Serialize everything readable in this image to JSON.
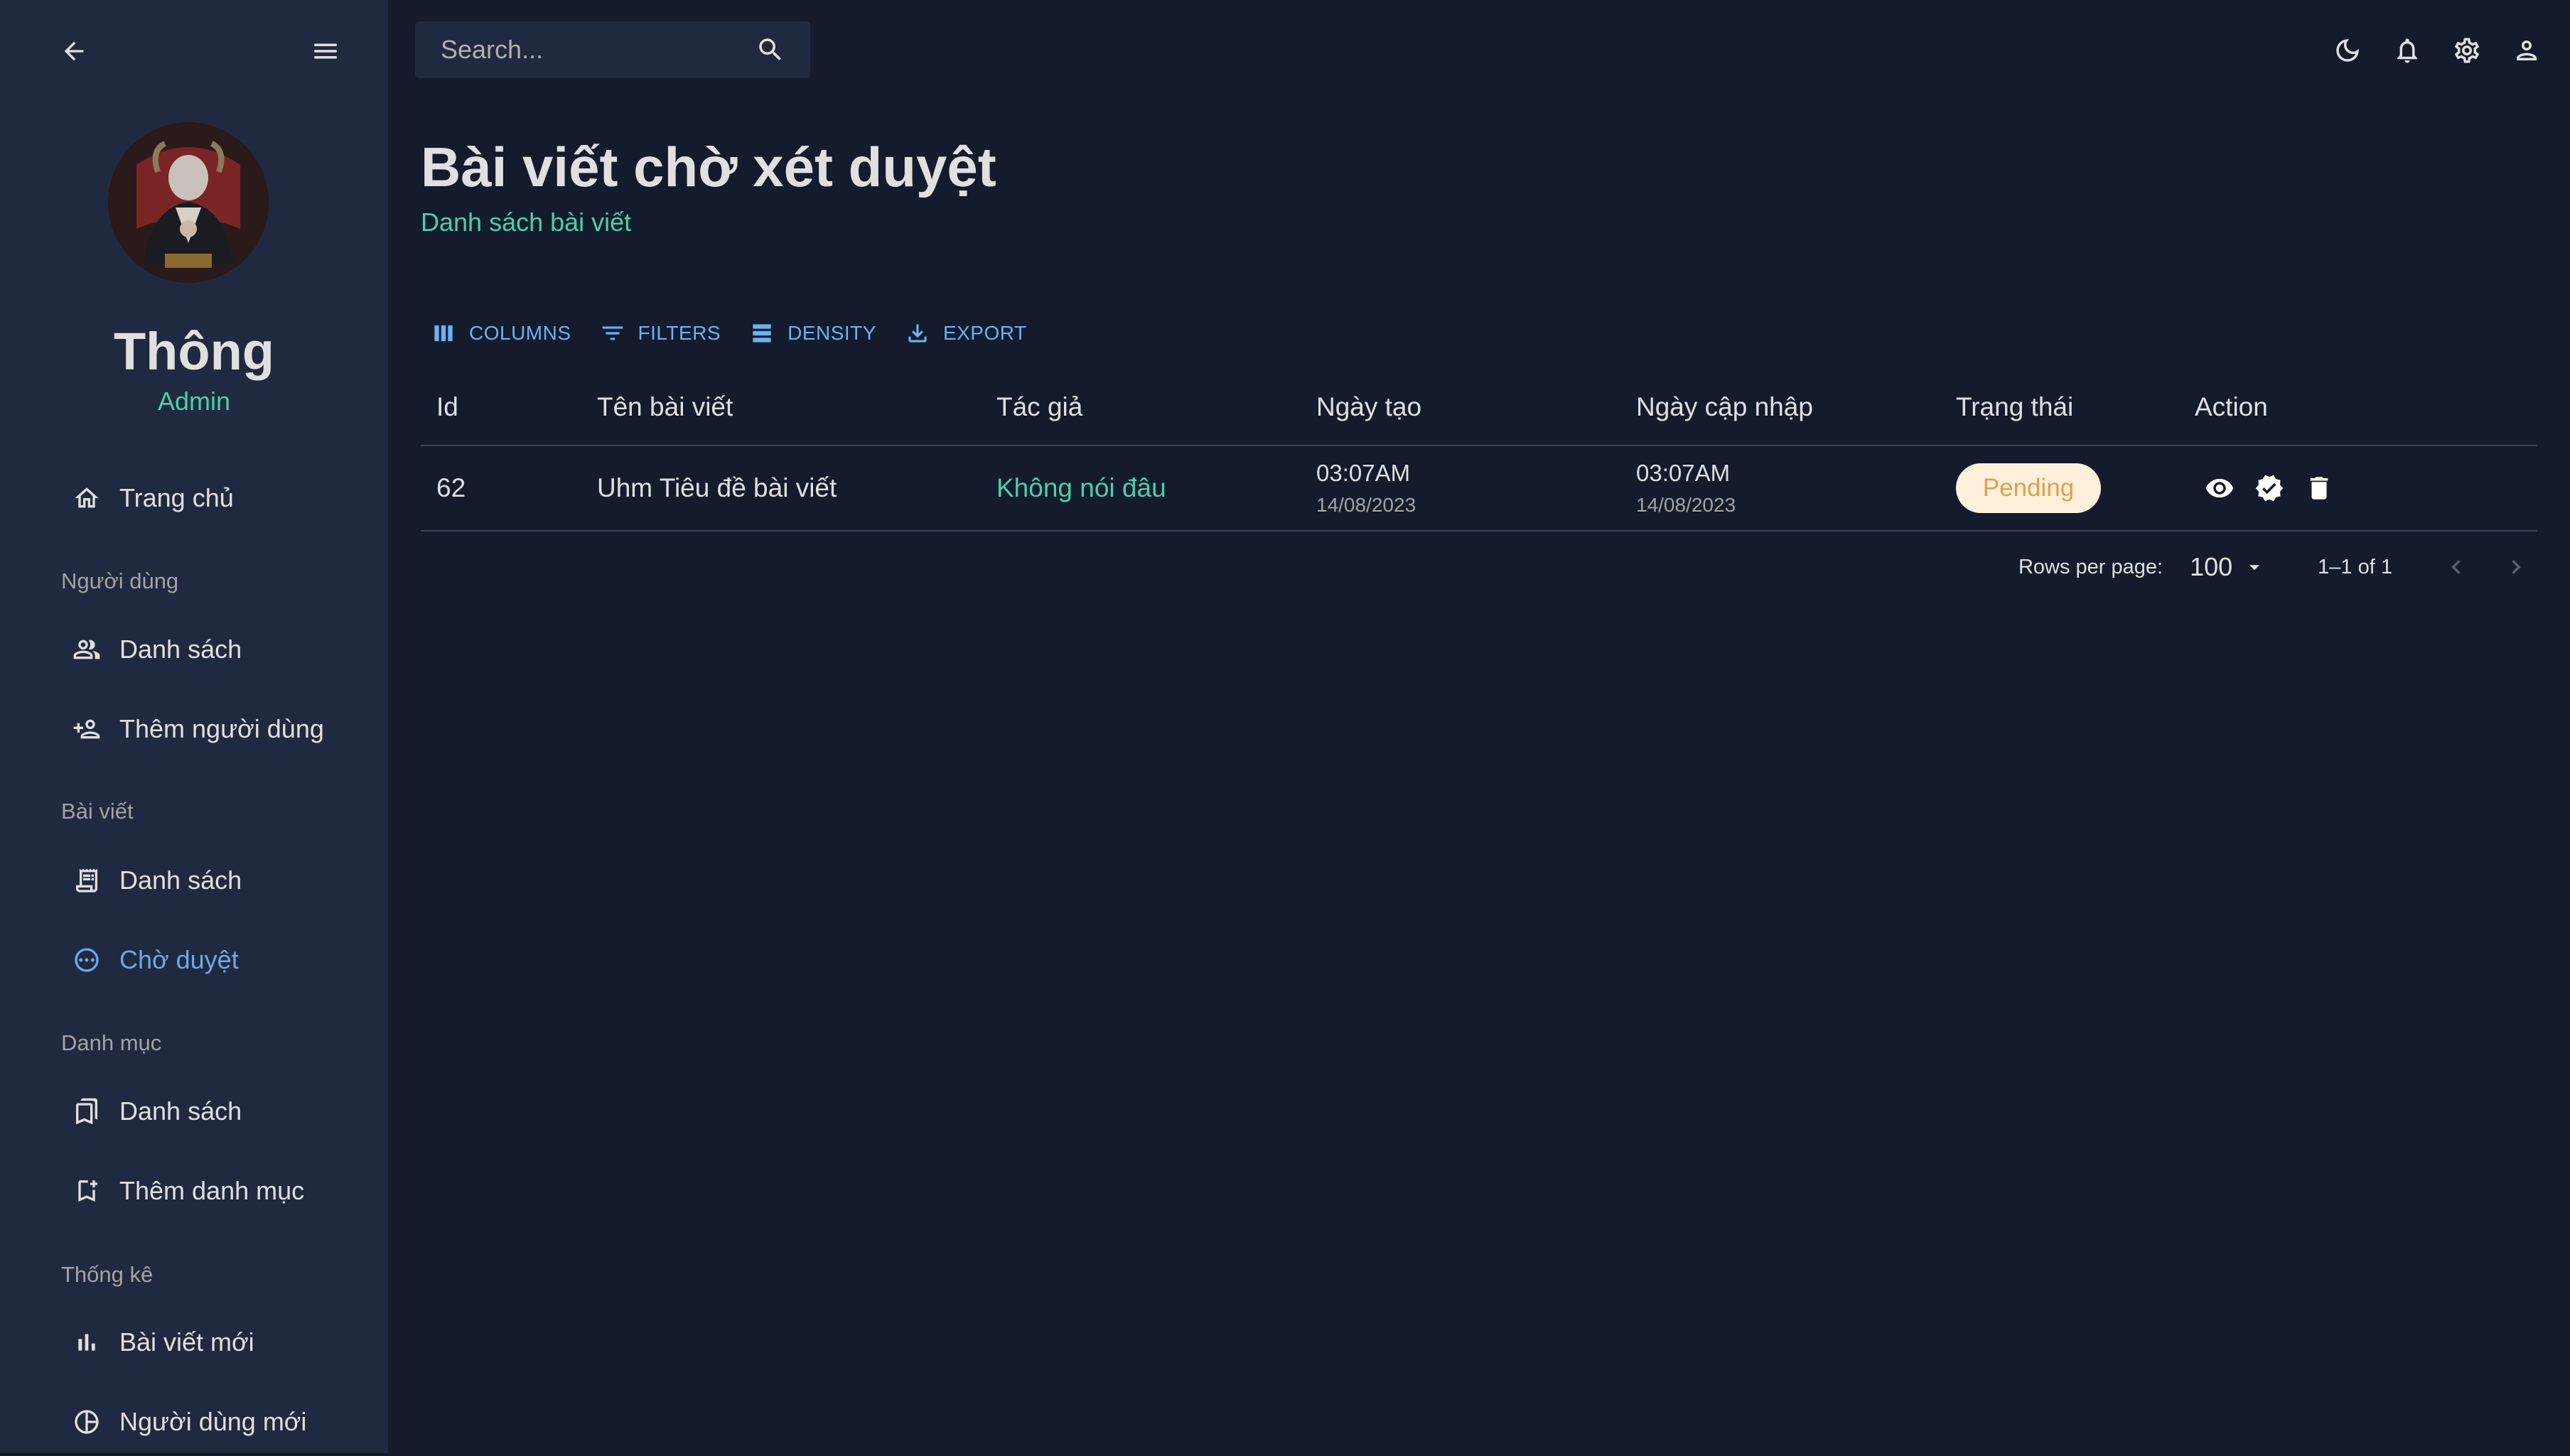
{
  "sidebar": {
    "user": {
      "name": "Thông",
      "role": "Admin"
    },
    "sections": {
      "users": "Người dùng",
      "posts": "Bài viết",
      "categories": "Danh mục",
      "stats": "Thống kê"
    },
    "items": {
      "home": "Trang chủ",
      "users_list": "Danh sách",
      "add_user": "Thêm người dùng",
      "posts_list": "Danh sách",
      "pending": "Chờ duyệt",
      "categories_list": "Danh sách",
      "add_category": "Thêm danh mục",
      "new_posts": "Bài viết mới",
      "new_users": "Người dùng mới"
    }
  },
  "topbar": {
    "search_placeholder": "Search..."
  },
  "header": {
    "title": "Bài viết chờ xét duyệt",
    "subtitle": "Danh sách bài viết"
  },
  "toolbar": {
    "columns": "COLUMNS",
    "filters": "FILTERS",
    "density": "DENSITY",
    "export": "EXPORT"
  },
  "table": {
    "columns": [
      "Id",
      "Tên bài viết",
      "Tác giả",
      "Ngày tạo",
      "Ngày cập nhập",
      "Trạng thái",
      "Action"
    ],
    "rows": [
      {
        "id": "62",
        "title": "Uhm Tiêu đề bài viết",
        "author": "Không nói đâu",
        "created_time": "03:07AM",
        "created_date": "14/08/2023",
        "updated_time": "03:07AM",
        "updated_date": "14/08/2023",
        "status": "Pending"
      }
    ]
  },
  "pagination": {
    "rows_per_page_label": "Rows per page:",
    "rows_per_page": "100",
    "range": "1–1 of 1"
  },
  "colors": {
    "background": "#141b2d",
    "sidebar": "#1f2a40",
    "accent_green": "#4cceac",
    "accent_blue": "#6cb2f0",
    "pending_bg": "#fff0dc",
    "pending_text": "#e2a04a"
  }
}
